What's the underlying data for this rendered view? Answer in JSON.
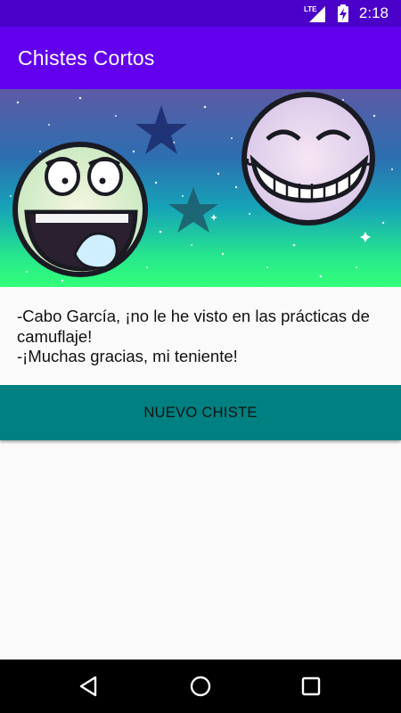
{
  "status_bar": {
    "network": "LTE",
    "time": "2:18",
    "icons": [
      "lte-signal-icon",
      "battery-charging-icon"
    ]
  },
  "app_bar": {
    "title": "Chistes Cortos"
  },
  "header_image": {
    "description_icon": "smiley-faces-banner",
    "colors": {
      "sky_top": "#5a5aa8",
      "sky_mid": "#1e88b8",
      "sky_bottom": "#2ff08a"
    }
  },
  "joke": {
    "text": "-Cabo García, ¡no le he visto en las prácticas de camuflaje!\n-¡Muchas gracias, mi teniente!"
  },
  "actions": {
    "new_joke_label": "NUEVO CHISTE"
  },
  "nav_bar": {
    "icons": [
      "back-icon",
      "home-icon",
      "recents-icon"
    ]
  },
  "colors": {
    "status_bar": "#4a00c9",
    "app_bar": "#6200ee",
    "button": "#008080",
    "background": "#fafafa"
  }
}
